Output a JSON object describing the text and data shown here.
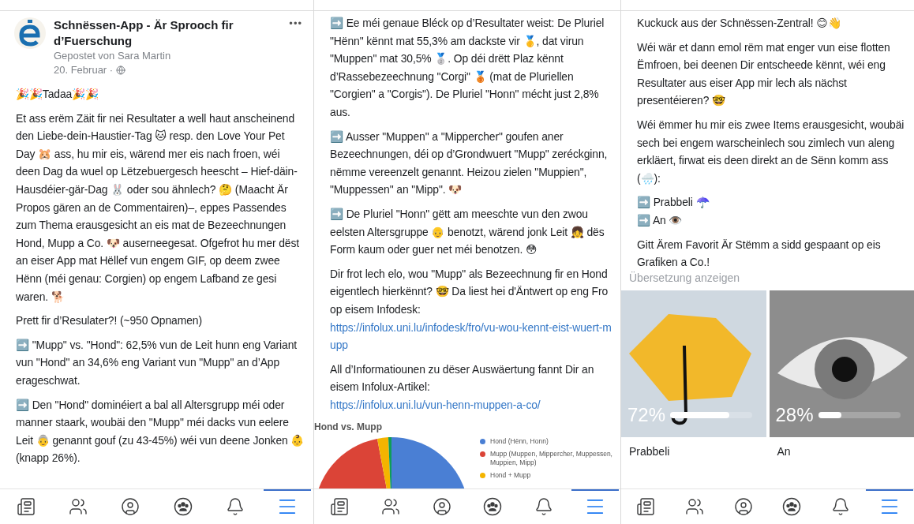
{
  "panels": [
    {
      "header": {
        "page_name": "Schnëssen-App - Är Sprooch fir d’Fuerschung",
        "posted_by": "Gepostet von Sara Martin",
        "date": "20. Februar ·",
        "more": "•••"
      },
      "paragraphs": [
        {
          "text": "🎉🎉Tadaa🎉🎉"
        },
        {
          "text": "Et ass erëm Zäit fir nei Resultater a well haut anscheinend den Liebe-dein-Haustier-Tag 🐱 resp. den Love Your Pet Day 🐹 ass, hu mir eis, wärend mer eis nach froen, wéi deen Dag da wuel op Lëtzebuergesch heescht – Hief-däin-Hausdéier-gär-Dag 🐰 oder sou ähnlech? 🤔 (Maacht Är Propos gären an de Commentairen)–, eppes Passendes zum Thema erausgesicht an eis mat de Bezeechnungen Hond, Mupp a Co. 🐶 auserneegesat. Ofgefrot hu mer dëst an eiser App mat Hëllef vun engem GIF, op deem zwee Hënn (méi genau: Corgien) op engem Lafband ze gesi waren. 🐕"
        },
        {
          "text": "Prett fir d’Resulater?! (~950 Opnamen)"
        },
        {
          "text": "➡️ \"Mupp\" vs. \"Hond\": 62,5% vun de Leit hunn eng Variant vun \"Hond\" an 34,6% eng Variant vun \"Mupp\" an d’App erageschwat."
        },
        {
          "text": "➡️ Den \"Hond\" dominéiert a bal all Altersgrupp méi oder manner staark, woubäi den \"Mupp\" méi dacks vun eelere Leit 👵 genannt gouf (zu 43-45%) wéi vun deene Jonken 👶 (knapp 26%)."
        }
      ],
      "tabbar": [
        {
          "kind": "news",
          "selected": false
        },
        {
          "kind": "friends",
          "selected": false
        },
        {
          "kind": "profile",
          "selected": false
        },
        {
          "kind": "groups",
          "selected": false
        },
        {
          "kind": "bell",
          "selected": false
        },
        {
          "kind": "menu",
          "selected": true
        }
      ]
    },
    {
      "paragraphs": [
        {
          "text": "➡️ Ee méi genaue Bléck op d’Resultater weist: De Pluriel \"Hënn\" kënnt mat 55,3% am dackste vir 🥇, dat virun \"Muppen\" mat 30,5% 🥈. Op déi drëtt Plaz kënnt d’Rassebezeechnung \"Corgi\" 🥉 (mat de Pluriellen \"Corgien\" a \"Corgis\"). De Pluriel \"Honn\" mécht just 2,8% aus."
        },
        {
          "text": "➡️ Ausser \"Muppen\" a \"Mippercher\" goufen aner Bezeechnungen, déi op d’Grondwuert \"Mupp\" zeréckginn, nëmme vereenzelt genannt. Heizou zielen \"Muppien\", \"Muppessen\" an \"Mipp\". 🐶"
        },
        {
          "text": "➡️ De Pluriel \"Honn\" gëtt am meeschte vun den zwou eelsten Altersgruppe 👴 benotzt, wärend jonk Leit 👧 dës Form kaum oder guer net méi benotzen. 😳"
        },
        {
          "text": "Dir frot lech elo, wou \"Mupp\" als Bezeechnung fir en Hond eigentlech hierkënnt? 🤓 Da liest hei d'Äntwert op eng Fro op eisem Infodesk: ",
          "link": "https://infolux.uni.lu/infodesk/fro/vu-wou-kennt-eist-wuert-mupp"
        },
        {
          "text": "All d’Informatiounen zu dëser Auswäertung fannt Dir an eisem Infolux-Artikel: ",
          "link": "https://infolux.uni.lu/vun-henn-muppen-a-co/"
        }
      ],
      "chart": {
        "title": "Hond vs. Mupp",
        "legend": [
          {
            "label": "Hond (Hënn, Honn)",
            "color": "#4a7fd4"
          },
          {
            "label": "Mupp (Muppen, Mippercher, Muppessen, Muppien, Mipp)",
            "color": "#db4437"
          },
          {
            "label": "Hond + Mupp",
            "color": "#f4b400"
          }
        ]
      },
      "tabbar": [
        {
          "kind": "news",
          "selected": false
        },
        {
          "kind": "friends",
          "selected": false
        },
        {
          "kind": "profile",
          "selected": false
        },
        {
          "kind": "groups",
          "selected": false
        },
        {
          "kind": "bell",
          "selected": false
        },
        {
          "kind": "menu",
          "selected": true
        }
      ]
    },
    {
      "paragraphs": [
        {
          "text": "Kuckuck aus der Schnëssen-Zentral! 😊👋"
        },
        {
          "text": "Wéi wär et dann emol rëm mat enger vun eise flotten Ëmfroen, bei deenen Dir entscheede kënnt, wéi eng Resultater aus eiser App mir lech als nächst presentéieren? 🤓"
        },
        {
          "text": "Wéi ëmmer hu mir eis zwee Items erausgesicht, woubäi sech bei engem warscheinlech sou zimlech vun aleng erkläert, firwat eis deen direkt an de Sënn komm ass (🌧️):"
        },
        {
          "text": "➡️ Prabbeli ☂️\n➡️ An 👁️"
        },
        {
          "text": "Gitt Ärem Favorit Är Stëmm a sidd gespaant op eis Grafiken a Co.!"
        }
      ],
      "translate": "Übersetzung anzeigen",
      "poll": [
        {
          "kind": "umbrella",
          "percent": "72%",
          "level": 0.72,
          "label": "Prabbeli"
        },
        {
          "kind": "eye",
          "percent": "28%",
          "level": 0.28,
          "label": "An"
        }
      ],
      "tabbar": [
        {
          "kind": "news",
          "selected": false
        },
        {
          "kind": "friends",
          "selected": false
        },
        {
          "kind": "profile",
          "selected": false
        },
        {
          "kind": "groups",
          "selected": false
        },
        {
          "kind": "bell",
          "selected": false
        },
        {
          "kind": "menu",
          "selected": true
        }
      ]
    }
  ]
}
